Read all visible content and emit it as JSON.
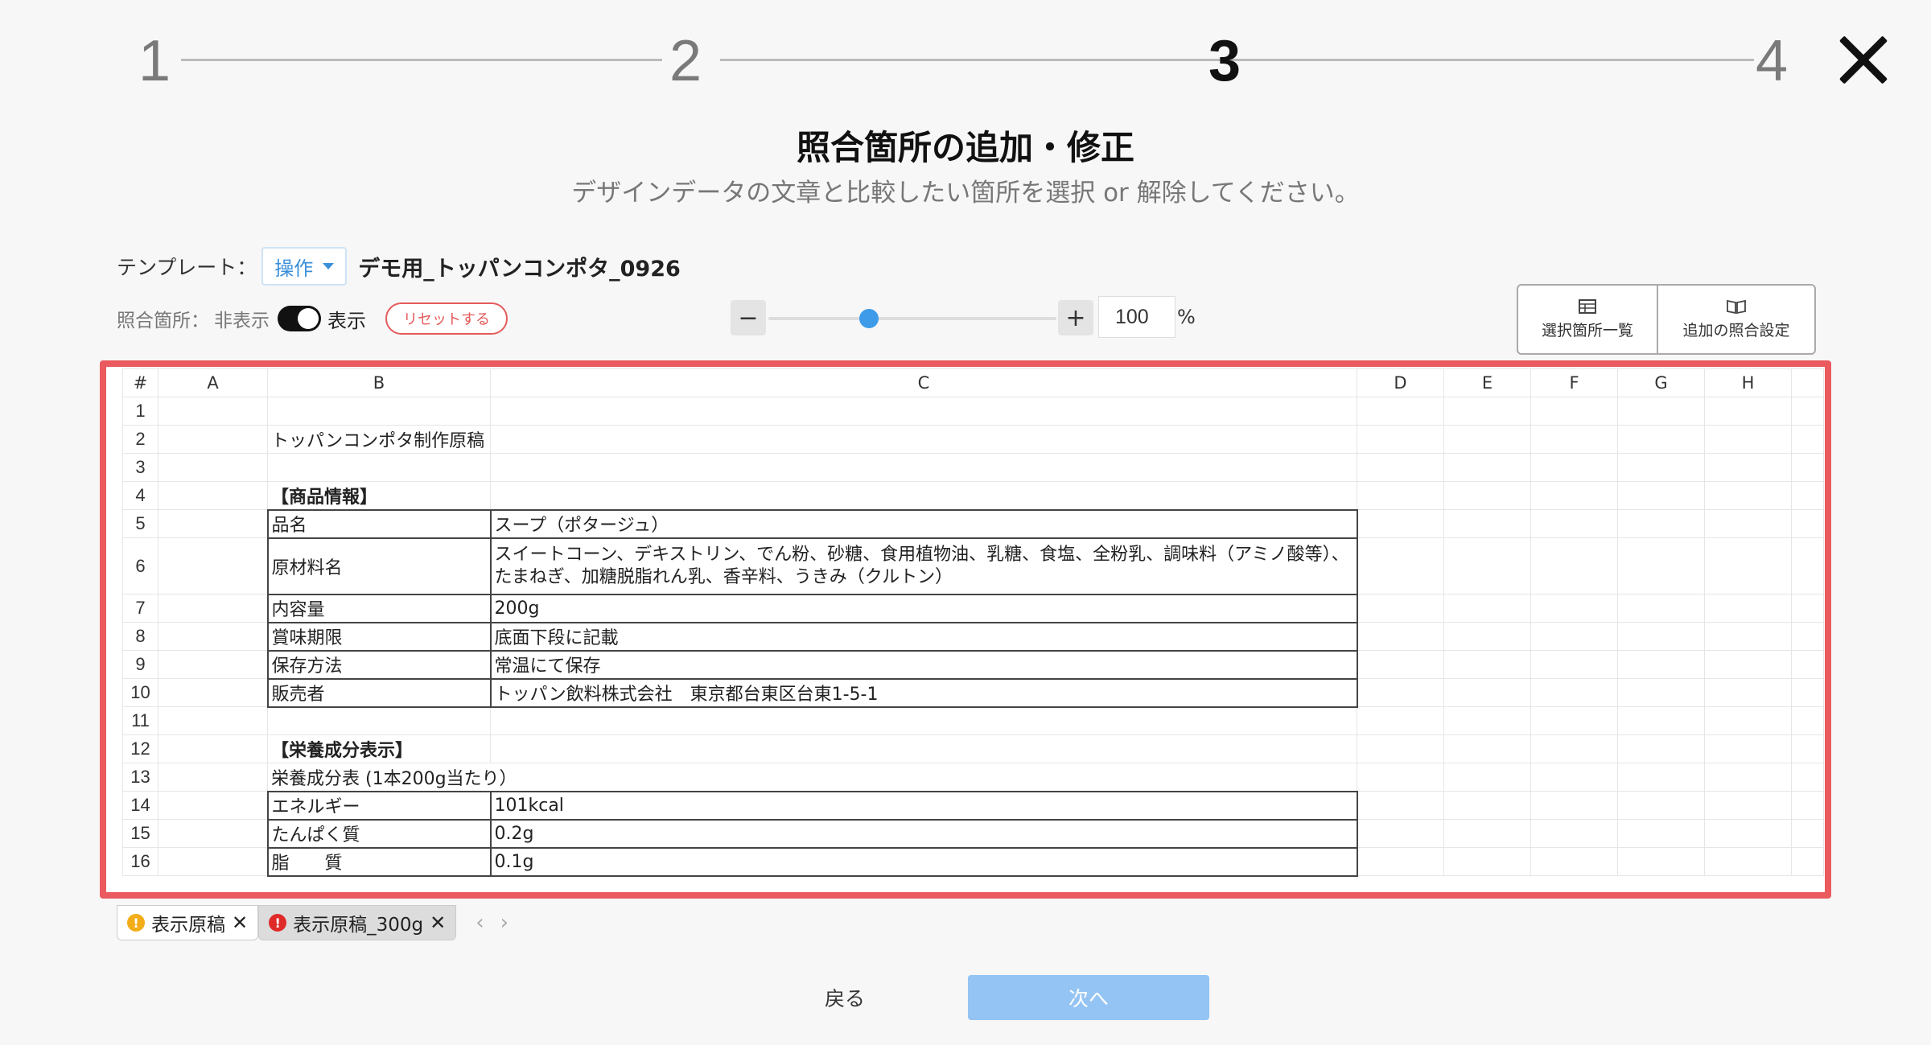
{
  "stepper": {
    "steps": [
      "1",
      "2",
      "3",
      "4"
    ],
    "active": "3"
  },
  "header": {
    "title": "照合箇所の追加・修正",
    "subtitle": "デザインデータの文章と比較したい箇所を選択 or 解除してください。"
  },
  "template": {
    "label": "テンプレート：",
    "operation": "操作",
    "name": "デモ用_トッパンコンポタ_0926"
  },
  "controls": {
    "label": "照合箇所：",
    "hide_label": "非表示",
    "show_label": "表示",
    "reset": "リセットする",
    "zoom_minus": "−",
    "zoom_plus": "+",
    "zoom_value": "100",
    "zoom_unit": "%",
    "zoom_level": 0.35
  },
  "side_buttons": {
    "list": "選択箇所一覧",
    "settings": "追加の照合設定"
  },
  "sheet": {
    "corner": "#",
    "columns": [
      "A",
      "B",
      "C",
      "D",
      "E",
      "F",
      "G",
      "H"
    ],
    "rows": [
      {
        "n": "1",
        "b": "",
        "c": ""
      },
      {
        "n": "2",
        "b": "トッパンコンポタ制作原稿",
        "c": ""
      },
      {
        "n": "3",
        "b": "",
        "c": ""
      },
      {
        "n": "4",
        "b": "【商品情報】",
        "c": ""
      },
      {
        "n": "5",
        "b": "品名",
        "c": "スープ（ポタージュ）"
      },
      {
        "n": "6",
        "b": "原材料名",
        "c": "スイートコーン、デキストリン、でん粉、砂糖、食用植物油、乳糖、食塩、全粉乳、調味料（アミノ酸等）、たまねぎ、加糖脱脂れん乳、香辛料、うきみ（クルトン）"
      },
      {
        "n": "7",
        "b": "内容量",
        "c": "200g"
      },
      {
        "n": "8",
        "b": "賞味期限",
        "c": "底面下段に記載"
      },
      {
        "n": "9",
        "b": "保存方法",
        "c": "常温にて保存"
      },
      {
        "n": "10",
        "b": "販売者",
        "c": "トッパン飲料株式会社　東京都台東区台東1-5-1"
      },
      {
        "n": "11",
        "b": "",
        "c": ""
      },
      {
        "n": "12",
        "b": "【栄養成分表示】",
        "c": ""
      },
      {
        "n": "13",
        "b": "栄養成分表 (1本200g当たり）",
        "c": ""
      },
      {
        "n": "14",
        "b": "エネルギー",
        "c": "101kcal"
      },
      {
        "n": "15",
        "b": "たんぱく質",
        "c": "0.2g"
      },
      {
        "n": "16",
        "b": "脂　　質",
        "c": "0.1g"
      }
    ]
  },
  "sheet_tabs": [
    {
      "label": "表示原稿",
      "status": "!",
      "close": "✕"
    },
    {
      "label": "表示原稿_300g",
      "status": "!",
      "close": "✕"
    }
  ],
  "tab_nav": {
    "prev": "‹",
    "next": "›"
  },
  "footer": {
    "back": "戻る",
    "next": "次へ"
  },
  "colors": {
    "accent": "#3d9be9",
    "frame": "#ea5a5e",
    "next_disabled": "#94c4f3"
  }
}
